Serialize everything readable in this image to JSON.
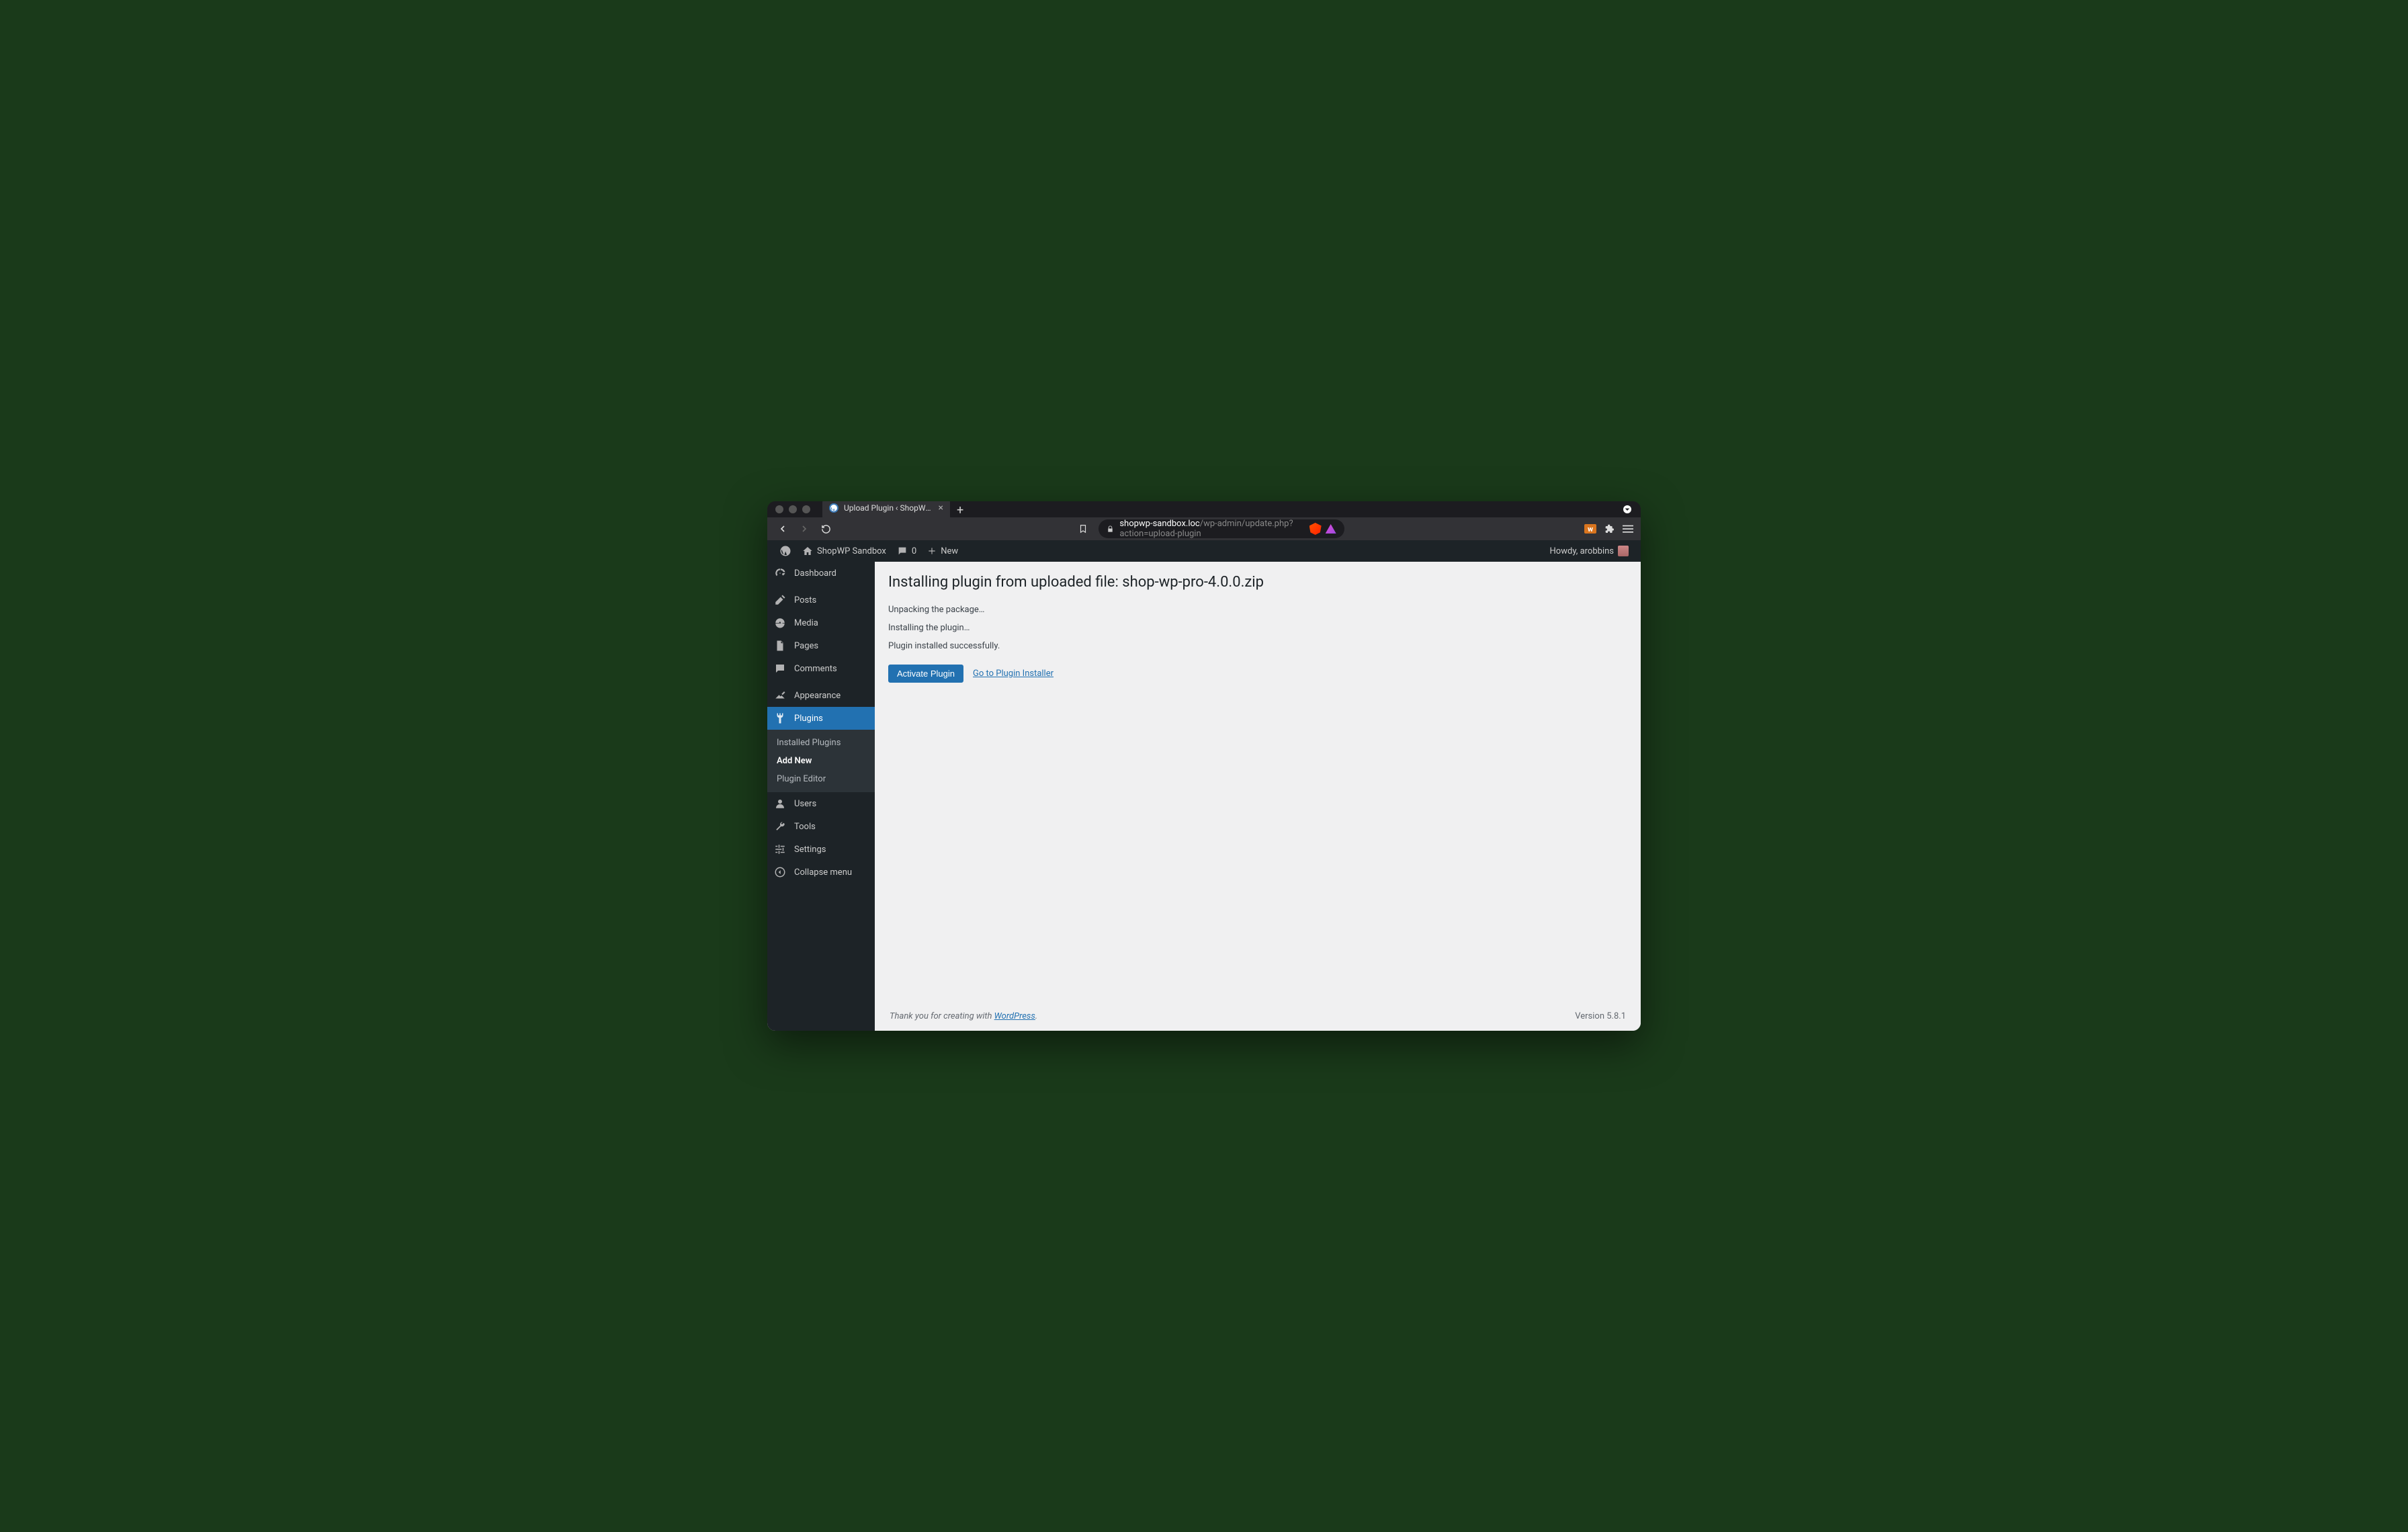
{
  "browser": {
    "tab_title": "Upload Plugin ‹ ShopWP Sandb",
    "url_host": "shopwp-sandbox.loc",
    "url_path": "/wp-admin/update.php?action=upload-plugin"
  },
  "adminbar": {
    "site_name": "ShopWP Sandbox",
    "comments_count": "0",
    "new_label": "New",
    "howdy_prefix": "Howdy, ",
    "user_name": "arobbins"
  },
  "sidebar": {
    "dashboard": "Dashboard",
    "posts": "Posts",
    "media": "Media",
    "pages": "Pages",
    "comments": "Comments",
    "appearance": "Appearance",
    "plugins": "Plugins",
    "plugins_sub": {
      "installed": "Installed Plugins",
      "add_new": "Add New",
      "editor": "Plugin Editor"
    },
    "users": "Users",
    "tools": "Tools",
    "settings": "Settings",
    "collapse": "Collapse menu"
  },
  "content": {
    "title": "Installing plugin from uploaded file: shop-wp-pro-4.0.0.zip",
    "status1": "Unpacking the package…",
    "status2": "Installing the plugin…",
    "status3": "Plugin installed successfully.",
    "activate_btn": "Activate Plugin",
    "installer_link": "Go to Plugin Installer"
  },
  "footer": {
    "thanks_prefix": "Thank you for creating with ",
    "wp_link": "WordPress",
    "version": "Version 5.8.1"
  }
}
